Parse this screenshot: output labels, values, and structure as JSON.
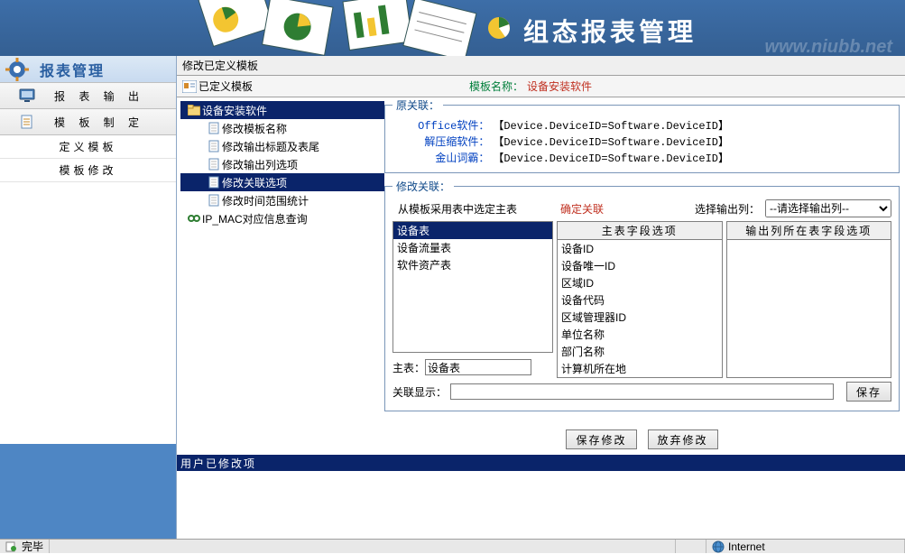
{
  "banner": {
    "title": "组态报表管理",
    "watermark": "www.niubb.net"
  },
  "left": {
    "title": "报表管理",
    "items": [
      {
        "label": "报 表 输 出",
        "icon": "monitor"
      },
      {
        "label": "模 板 制 定",
        "icon": "page"
      }
    ],
    "subitems": [
      {
        "label": "定义模板"
      },
      {
        "label": "模板修改"
      }
    ]
  },
  "breadcrumb": "修改已定义模板",
  "tplbar": {
    "label": "已定义模板"
  },
  "template": {
    "label": "模板名称：",
    "value": "设备安装软件"
  },
  "tree": {
    "root": "设备安装软件",
    "children": [
      "修改模板名称",
      "修改输出标题及表尾",
      "修改输出列选项",
      "修改关联选项",
      "修改时间范围统计"
    ],
    "selected_index": 3,
    "extra": "IP_MAC对应信息查询"
  },
  "orig_assoc": {
    "legend": "原关联：",
    "rows": [
      {
        "k": "Office软件：",
        "v": "【Device.DeviceID=Software.DeviceID】"
      },
      {
        "k": "解压缩软件：",
        "v": "【Device.DeviceID=Software.DeviceID】"
      },
      {
        "k": "金山词霸：",
        "v": "【Device.DeviceID=Software.DeviceID】"
      }
    ]
  },
  "mod_assoc": {
    "legend": "修改关联：",
    "row1_text": "从模板采用表中选定主表",
    "confirm": "确定关联",
    "sel_label": "选择输出列：",
    "sel_placeholder": "--请选择输出列--",
    "list1_head": "",
    "list1": [
      "设备表",
      "设备流量表",
      "软件资产表"
    ],
    "list1_selected": 0,
    "list2_head": "主表字段选项",
    "list2": [
      "设备ID",
      "设备唯一ID",
      "区域ID",
      "设备代码",
      "区域管理器ID",
      "单位名称",
      "部门名称",
      "计算机所在地"
    ],
    "list3_head": "输出列所在表字段选项",
    "list3": [],
    "main_label": "主表：",
    "main_value": "设备表",
    "rel_show_label": "关联显示：",
    "save_btn": "保存"
  },
  "bottom": {
    "save": "保存修改",
    "discard": "放弃修改"
  },
  "strip": "用户已修改项",
  "status": {
    "done": "完毕",
    "zone": "Internet"
  }
}
